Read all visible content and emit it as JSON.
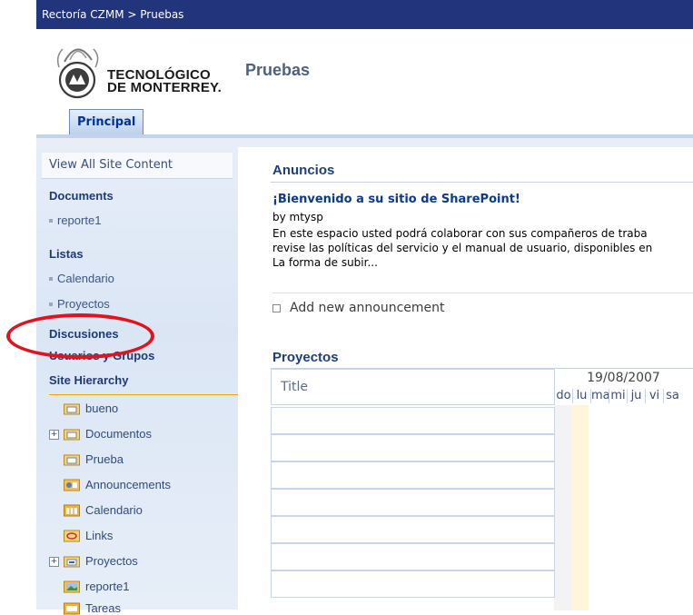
{
  "breadcrumb": {
    "text": "Rectoría CZMM > Pruebas"
  },
  "logo": {
    "line1": "TECNOLÓGICO",
    "line2": "DE MONTERREY."
  },
  "site": {
    "title": "Pruebas"
  },
  "tabs": [
    {
      "label": "Principal",
      "selected": true
    }
  ],
  "leftnav": {
    "view_all": "View All Site Content",
    "documents_heading": "Documents",
    "documents_items": [
      "reporte1"
    ],
    "lists_heading": "Listas",
    "lists_items": [
      "Calendario",
      "Proyectos"
    ],
    "discussions_heading": "Discusiones",
    "people_heading": "Usuarios y Grupos",
    "hierarchy_heading": "Site Hierarchy",
    "hierarchy": [
      {
        "label": "bueno",
        "icon": "site-folder-icon",
        "expandable": false
      },
      {
        "label": "Documentos",
        "icon": "site-folder-icon",
        "expandable": true
      },
      {
        "label": "Prueba",
        "icon": "site-folder-icon",
        "expandable": false
      },
      {
        "label": "Announcements",
        "icon": "announcements-list-icon",
        "expandable": false
      },
      {
        "label": "Calendario",
        "icon": "calendar-list-icon",
        "expandable": false
      },
      {
        "label": "Links",
        "icon": "links-list-icon",
        "expandable": false
      },
      {
        "label": "Proyectos",
        "icon": "tasks-list-icon",
        "expandable": true
      },
      {
        "label": "reporte1",
        "icon": "picture-library-icon",
        "expandable": false
      },
      {
        "label": "Tareas",
        "icon": "tasks-list-icon",
        "expandable": false
      }
    ]
  },
  "announcements": {
    "title": "Anuncios",
    "item_title": "¡Bienvenido a su sitio de SharePoint!",
    "item_by": "by mtysp",
    "item_body": [
      "En este espacio usted podrá colaborar con sus compañeros de traba",
      "revise las políticas del servicio y el manual de usuario, disponibles en",
      "La forma de subir..."
    ],
    "add_link": "Add new announcement"
  },
  "projects": {
    "title": "Proyectos",
    "column_title": "Title",
    "week_date": "19/08/2007",
    "days": [
      "do",
      "lu",
      "ma",
      "mi",
      "ju",
      "vi",
      "sa"
    ]
  },
  "colors": {
    "topbar": "#21347c",
    "heading": "#1d3a78",
    "highlight": "#e0141e",
    "today": "#fff6d9"
  }
}
